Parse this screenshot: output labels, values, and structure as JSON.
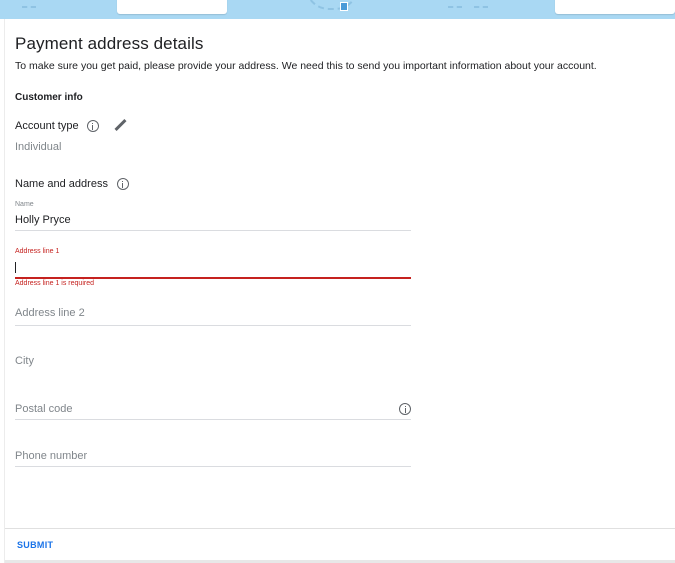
{
  "header": {
    "title": "Payment address details",
    "subtitle": "To make sure you get paid, please provide your address. We need this to send you important information about your account."
  },
  "customer_info": {
    "heading": "Customer info",
    "account_type_label": "Account type",
    "account_type_value": "Individual"
  },
  "name_and_address": {
    "label": "Name and address",
    "name_label": "Name",
    "name_value": "Holly Pryce",
    "address1_label": "Address line 1",
    "address1_value": "",
    "address1_error": "Address line 1 is required",
    "address2_placeholder": "Address line 2",
    "city_placeholder": "City",
    "postal_placeholder": "Postal code",
    "phone_placeholder": "Phone number"
  },
  "footer": {
    "submit_label": "SUBMIT"
  },
  "colors": {
    "accent": "#1a73e8",
    "error": "#c5221f",
    "banner": "#a9d8f3"
  },
  "icons": {
    "info": "info-circle-icon",
    "edit": "pencil-icon"
  }
}
